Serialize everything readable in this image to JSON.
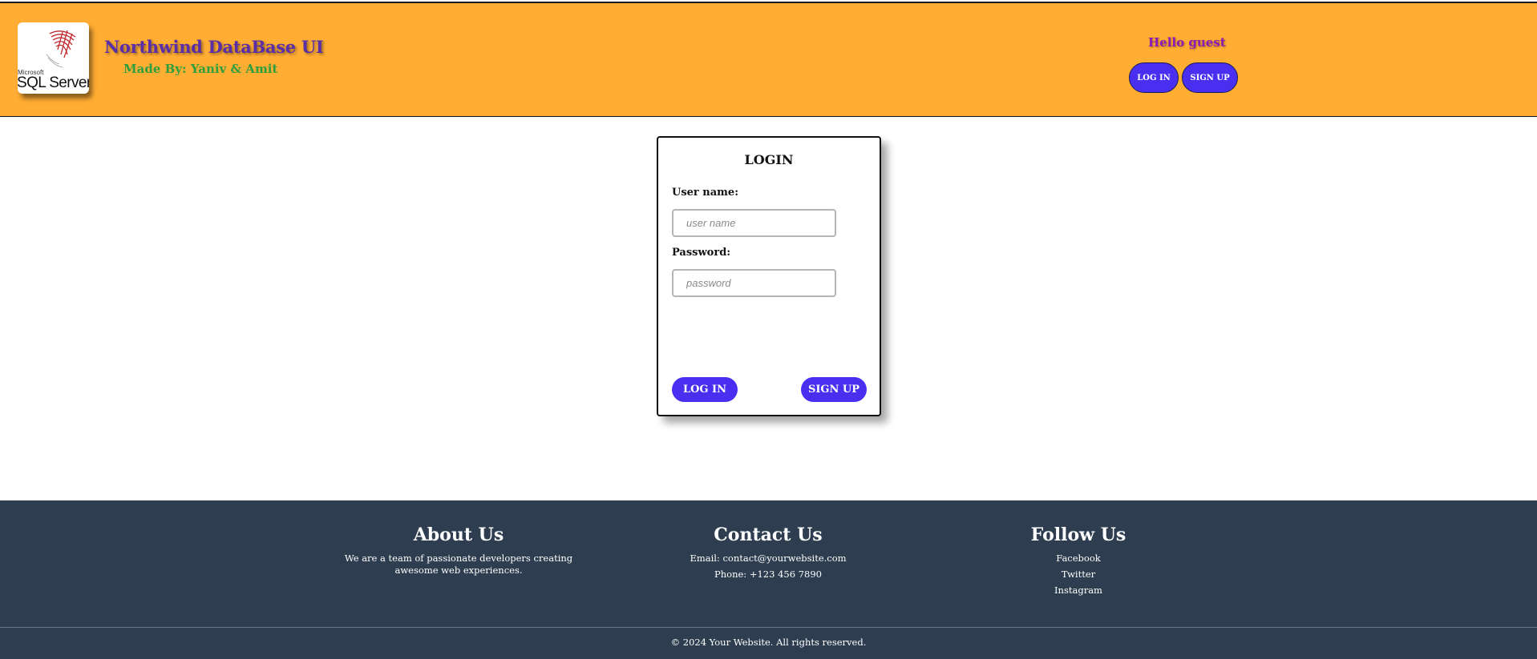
{
  "header": {
    "logo_small": "Microsoft",
    "logo_main": "SQL Server",
    "title": "Northwind DataBase UI",
    "subtitle": "Made By: Yaniv & Amit",
    "greeting": "Hello guest",
    "login_button": "LOG IN",
    "signup_button": "SIGN UP"
  },
  "login_form": {
    "title": "LOGIN",
    "username_label": "User name:",
    "username_placeholder": "user name",
    "password_label": "Password:",
    "password_placeholder": "password",
    "login_button": "LOG IN",
    "signup_button": "SIGN UP"
  },
  "footer": {
    "about": {
      "title": "About Us",
      "text": "We are a team of passionate developers creating awesome web experiences."
    },
    "contact": {
      "title": "Contact Us",
      "email": "Email: contact@yourwebsite.com",
      "phone": "Phone: +123 456 7890"
    },
    "follow": {
      "title": "Follow Us",
      "links": [
        "Facebook",
        "Twitter",
        "Instagram"
      ]
    },
    "copyright": "© 2024 Your Website. All rights reserved."
  },
  "colors": {
    "header_bg": "#ffad33",
    "button_bg": "#4a2ff0",
    "footer_bg": "#2e3e50",
    "title_color": "#5a2ea8",
    "subtitle_color": "#2e9e3e",
    "greeting_color": "#8b1ab8"
  }
}
